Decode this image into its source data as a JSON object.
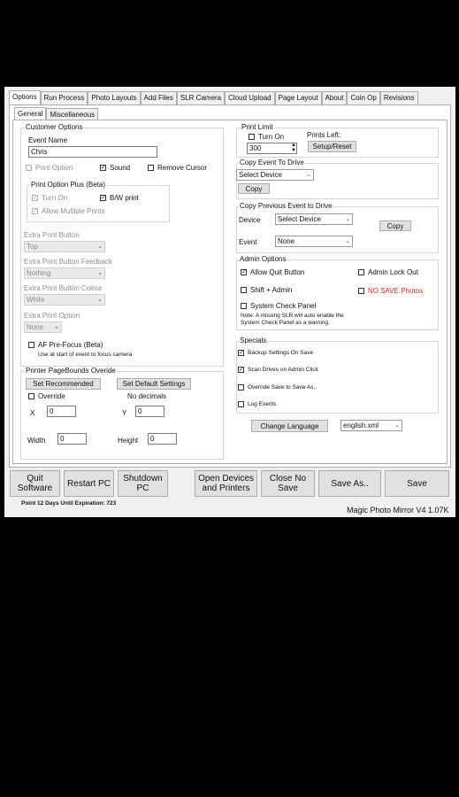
{
  "tabs": [
    "Options",
    "Run Process",
    "Photo Layouts",
    "Add Files",
    "SLR Camera",
    "Cloud Upload",
    "Page Layout",
    "About",
    "Coin Op",
    "Revisions"
  ],
  "subtabs": [
    "General",
    "Miscellaneous"
  ],
  "customer": {
    "title": "Customer Options",
    "event_name_label": "Event Name",
    "event_name_value": "Chris",
    "print_option": "Print Option",
    "sound": "Sound",
    "remove_cursor": "Remove Cursor"
  },
  "print_plus": {
    "title": "Print Option Plus (Beta)",
    "turn_on": "Turn On",
    "bw_print": "B/W print",
    "allow_multiple": "Allow Multiple Prints"
  },
  "extra_print_button": {
    "label": "Extra Print Button",
    "value": "Top"
  },
  "extra_print_feedback": {
    "label": "Extra Print Button Feedback",
    "value": "Nothing"
  },
  "extra_print_colour": {
    "label": "Extra Print Button Colour",
    "value": "White"
  },
  "extra_print_option": {
    "label": "Extra Print Option",
    "value": "None"
  },
  "af": {
    "label": "AF Pre-Focus (Beta)",
    "note": "Use at start of event to focus camera"
  },
  "pagebounds": {
    "title": "Printer PageBounds Overide",
    "set_recommended": "Set Recommended",
    "set_default": "Set Default Settings",
    "override": "Override",
    "no_decimals": "No decimals",
    "x_label": "X",
    "x_value": "0",
    "y_label": "Y",
    "y_value": "0",
    "width_label": "Width",
    "width_value": "0",
    "height_label": "Height",
    "height_value": "0"
  },
  "print_limit": {
    "title": "Print Limit",
    "turn_on": "Turn On",
    "value": "300",
    "prints_left": "Prints Left:",
    "setup_reset": "Setup/Reset"
  },
  "copy_event": {
    "title": "Copy Event To Drive",
    "device": "Select Device",
    "copy": "Copy"
  },
  "copy_prev": {
    "title": "Copy Previous Event to Drive",
    "device_label": "Device",
    "device_value": "Select Device",
    "event_label": "Event",
    "event_value": "None",
    "copy": "Copy"
  },
  "admin": {
    "title": "Admin Options",
    "allow_quit": "Allow Quit Button",
    "admin_lock": "Admin Lock Out",
    "shift_admin": "Shift + Admin",
    "no_save": "NO SAVE Photos",
    "system_check": "System Check Panel",
    "note1": "Note: A missing SLR will auto enable the",
    "note2": "System Check Panel as a warning."
  },
  "specials": {
    "title": "Specials",
    "backup": "Backup Settings On Save",
    "scan": "Scan Drives on Admin Click",
    "override_save": "Override Save to Save As..",
    "log_events": "Log Events"
  },
  "language": {
    "button": "Change Language",
    "value": "english.xml"
  },
  "bottom": {
    "quit1": "Quit",
    "quit2": "Software",
    "restart": "Restart PC",
    "shutdown1": "Shutdown",
    "shutdown2": "PC",
    "devices1": "Open Devices",
    "devices2": "and Printers",
    "close1": "Close No",
    "close2": "Save",
    "save_as": "Save As..",
    "save": "Save"
  },
  "status": {
    "expiration": "Point 12 Days Until Expiration: 723",
    "version": "Magic Photo Mirror V4 1.07K"
  },
  "icons": {
    "check": "checkmark-icon",
    "dropdown": "chevron-down-icon",
    "spin": "spinner-arrows-icon"
  }
}
